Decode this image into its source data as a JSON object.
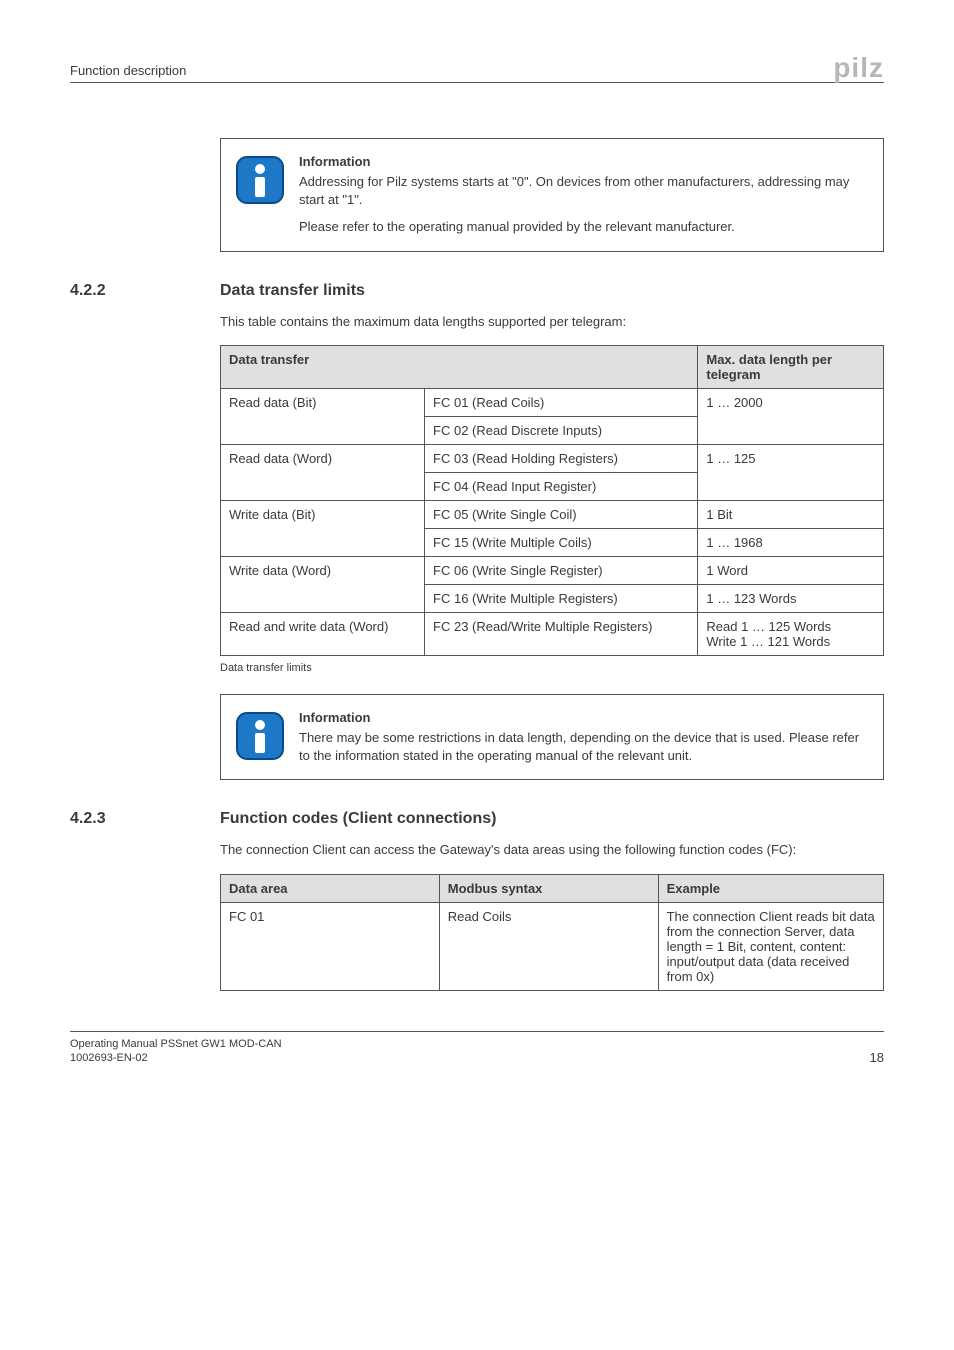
{
  "header": {
    "section": "Function description",
    "logo": "pilz"
  },
  "info1": {
    "title": "Information",
    "p1": "Addressing for Pilz systems starts at \"0\". On devices from other manufacturers, addressing may start at \"1\".",
    "p2": "Please refer to the operating manual provided by the relevant manufacturer."
  },
  "section422": {
    "num": "4.2.2",
    "title": "Data transfer limits",
    "intro": "This table contains the maximum data lengths supported per telegram:",
    "caption": "Data transfer limits"
  },
  "table1": {
    "head": {
      "col1": "Data transfer",
      "col3": "Max. data length per telegram"
    },
    "rows": {
      "r1c1": "Read data (Bit)",
      "r1c2": "FC 01 (Read Coils)",
      "r1c3": "1 … 2000",
      "r2c2": "FC 02 (Read Discrete Inputs)",
      "r3c1": "Read data (Word)",
      "r3c2": "FC 03 (Read Holding Registers)",
      "r3c3": "1 … 125",
      "r4c2": "FC 04 (Read Input Register)",
      "r5c1": "Write data (Bit)",
      "r5c2": "FC 05 (Write Single Coil)",
      "r5c3": "1 Bit",
      "r6c2": "FC 15 (Write Multiple Coils)",
      "r6c3": "1 … 1968",
      "r7c1": "Write data (Word)",
      "r7c2": "FC 06 (Write Single Register)",
      "r7c3": "1 Word",
      "r8c2": "FC 16 (Write Multiple Registers)",
      "r8c3": "1 … 123 Words",
      "r9c1": "Read and write data (Word)",
      "r9c2": "FC 23 (Read/Write Multiple Registers)",
      "r9c3a": "Read 1 … 125 Words",
      "r9c3b": "Write 1 … 121 Words"
    }
  },
  "info2": {
    "title": "Information",
    "p1": "There may be some restrictions in data length, depending on the device that is used. Please refer to the information stated in the operating manual of the relevant unit."
  },
  "section423": {
    "num": "4.2.3",
    "title": "Function codes (Client connections)",
    "intro": "The connection Client can access the Gateway's data areas using the following function codes (FC):"
  },
  "table2": {
    "head": {
      "col1": "Data area",
      "col2": "Modbus syntax",
      "col3": "Example"
    },
    "rows": {
      "r1c1": "FC 01",
      "r1c2": "Read Coils",
      "r1c3": "The connection Client reads bit data from the connection Server,\ndata length = 1 Bit, content, content: input/output data (data received from 0x)"
    }
  },
  "footer": {
    "line1": "Operating Manual PSSnet GW1 MOD-CAN",
    "line2": "1002693-EN-02",
    "page": "18"
  }
}
